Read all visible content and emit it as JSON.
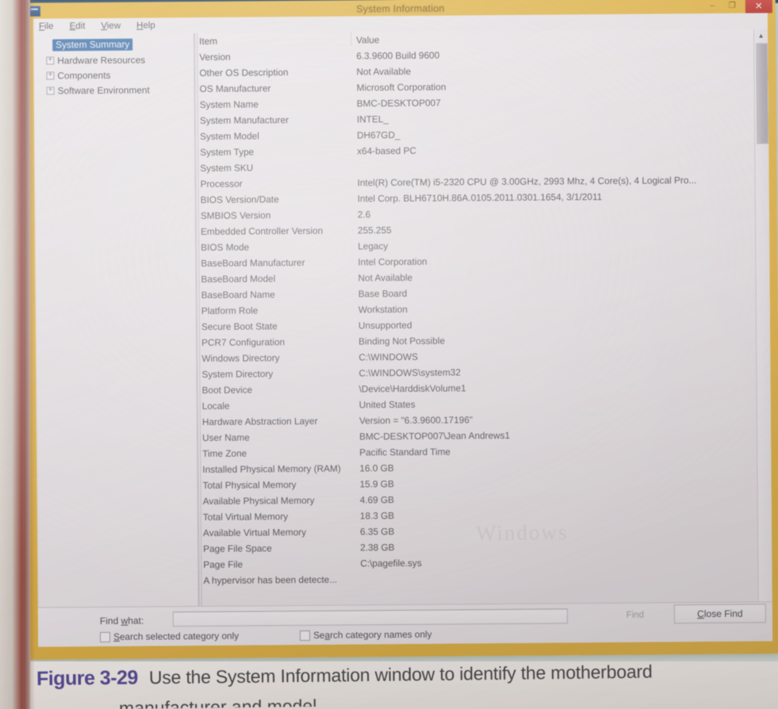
{
  "window": {
    "title": "System Information",
    "app_icon": "computer-icon",
    "controls": {
      "minimize": "–",
      "maximize": "❐",
      "close": "✕"
    }
  },
  "menubar": {
    "items": [
      {
        "label": "File",
        "accel": "F"
      },
      {
        "label": "Edit",
        "accel": "E"
      },
      {
        "label": "View",
        "accel": "V"
      },
      {
        "label": "Help",
        "accel": "H"
      }
    ]
  },
  "tree": {
    "items": [
      {
        "label": "System Summary",
        "selected": true,
        "expandable": false
      },
      {
        "label": "Hardware Resources",
        "selected": false,
        "expandable": true
      },
      {
        "label": "Components",
        "selected": false,
        "expandable": true
      },
      {
        "label": "Software Environment",
        "selected": false,
        "expandable": true
      }
    ]
  },
  "details": {
    "columns": [
      "Item",
      "Value"
    ],
    "rows": [
      {
        "item": "Version",
        "value": "6.3.9600 Build 9600"
      },
      {
        "item": "Other OS Description",
        "value": "Not Available"
      },
      {
        "item": "OS Manufacturer",
        "value": "Microsoft Corporation"
      },
      {
        "item": "System Name",
        "value": "BMC-DESKTOP007"
      },
      {
        "item": "System Manufacturer",
        "value": "INTEL_"
      },
      {
        "item": "System Model",
        "value": "DH67GD_"
      },
      {
        "item": "System Type",
        "value": "x64-based PC"
      },
      {
        "item": "System SKU",
        "value": ""
      },
      {
        "item": "Processor",
        "value": "Intel(R) Core(TM) i5-2320 CPU @ 3.00GHz, 2993 Mhz, 4 Core(s), 4 Logical Pro..."
      },
      {
        "item": "BIOS Version/Date",
        "value": "Intel Corp. BLH6710H.86A.0105.2011.0301.1654, 3/1/2011"
      },
      {
        "item": "SMBIOS Version",
        "value": "2.6"
      },
      {
        "item": "Embedded Controller Version",
        "value": "255.255"
      },
      {
        "item": "BIOS Mode",
        "value": "Legacy"
      },
      {
        "item": "BaseBoard Manufacturer",
        "value": "Intel Corporation"
      },
      {
        "item": "BaseBoard Model",
        "value": "Not Available"
      },
      {
        "item": "BaseBoard Name",
        "value": "Base Board"
      },
      {
        "item": "Platform Role",
        "value": "Workstation"
      },
      {
        "item": "Secure Boot State",
        "value": "Unsupported"
      },
      {
        "item": "PCR7 Configuration",
        "value": "Binding Not Possible"
      },
      {
        "item": "Windows Directory",
        "value": "C:\\WINDOWS"
      },
      {
        "item": "System Directory",
        "value": "C:\\WINDOWS\\system32"
      },
      {
        "item": "Boot Device",
        "value": "\\Device\\HarddiskVolume1"
      },
      {
        "item": "Locale",
        "value": "United States"
      },
      {
        "item": "Hardware Abstraction Layer",
        "value": "Version = \"6.3.9600.17196\""
      },
      {
        "item": "User Name",
        "value": "BMC-DESKTOP007\\Jean Andrews1"
      },
      {
        "item": "Time Zone",
        "value": "Pacific Standard Time"
      },
      {
        "item": "Installed Physical Memory (RAM)",
        "value": "16.0 GB"
      },
      {
        "item": "Total Physical Memory",
        "value": "15.9 GB"
      },
      {
        "item": "Available Physical Memory",
        "value": "4.69 GB"
      },
      {
        "item": "Total Virtual Memory",
        "value": "18.3 GB"
      },
      {
        "item": "Available Virtual Memory",
        "value": "6.35 GB"
      },
      {
        "item": "Page File Space",
        "value": "2.38 GB"
      },
      {
        "item": "Page File",
        "value": "C:\\pagefile.sys"
      },
      {
        "item": "A hypervisor has been detecte...",
        "value": "",
        "full_width": true
      }
    ]
  },
  "scrollbar": {
    "up_arrow": "▲",
    "down_arrow": "▼"
  },
  "findbar": {
    "label": "Find what:",
    "label_accel": "w",
    "input_value": "",
    "input_placeholder": "",
    "find_button": "Find",
    "find_button_accel": "d",
    "close_button": "Close Find",
    "close_button_accel": "C",
    "checkbox_selected_category": "Search selected category only",
    "checkbox_selected_category_accel": "S",
    "checkbox_selected_category_checked": false,
    "checkbox_category_names": "Search category names only",
    "checkbox_category_names_accel": "a",
    "checkbox_category_names_checked": false
  },
  "caption": {
    "figure_number": "Figure 3-29",
    "figure_text": "Use the System Information window to identify the motherboard",
    "next_line": "manufacturer and model"
  },
  "ghost_text": "Windows",
  "colors": {
    "titlebar": "#dfb44a",
    "client": "#e6e2e6",
    "selection": "#3b6ea8",
    "close_button": "#c9443e",
    "desktop": "#cbdad6",
    "caption_accent": "#4a3f8f"
  }
}
